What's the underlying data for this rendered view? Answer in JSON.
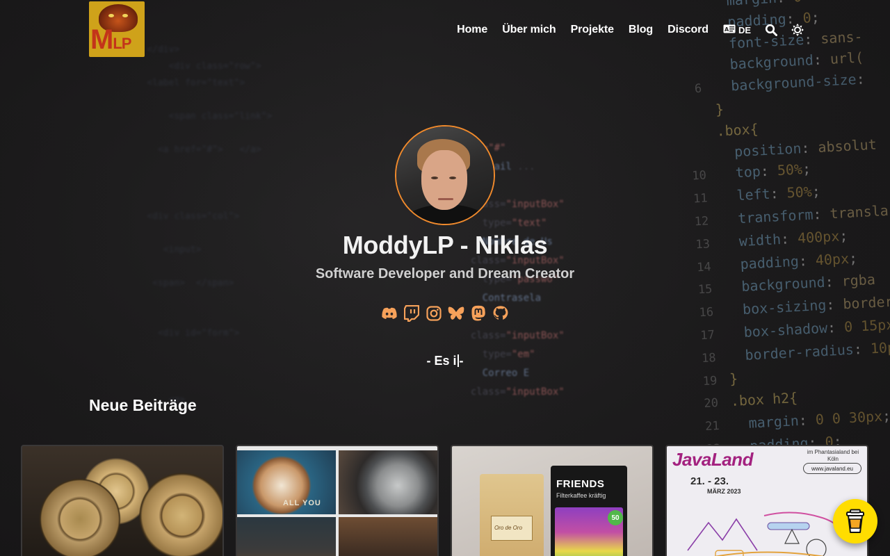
{
  "nav": {
    "items": [
      "Home",
      "Über mich",
      "Projekte",
      "Blog",
      "Discord"
    ],
    "language": "DE"
  },
  "hero": {
    "name": "ModdyLP - Niklas",
    "subtitle": "Software Developer and Dream Creator",
    "tagline_before": "- Es i",
    "tagline_after": "-",
    "socials": [
      "discord-icon",
      "twitch-icon",
      "instagram-icon",
      "bluesky-icon",
      "mastodon-icon",
      "github-icon"
    ]
  },
  "posts": {
    "heading": "Neue Beiträge",
    "cards": [
      {
        "image": "gears"
      },
      {
        "image": "coffee-collage",
        "mug_text": "ALL YOU"
      },
      {
        "image": "coffee-bags",
        "bag_text": "FRIENDS",
        "bag_sub": "Filterkaffee kräftig",
        "badge": "50",
        "bag_label": "Oro de Oro"
      },
      {
        "image": "javaland-poster",
        "title": "JavaLand",
        "date": "21. - 23.",
        "month": "MÄRZ 2023",
        "place": "im Phantasialand bei Köln",
        "url": "www.javaland.eu"
      }
    ]
  },
  "logo": {
    "text_big": "M",
    "text_small": "LP"
  },
  "colors": {
    "accent": "#f08a2c",
    "background": "#1c1b1c",
    "coffee": "#ffdd00"
  }
}
